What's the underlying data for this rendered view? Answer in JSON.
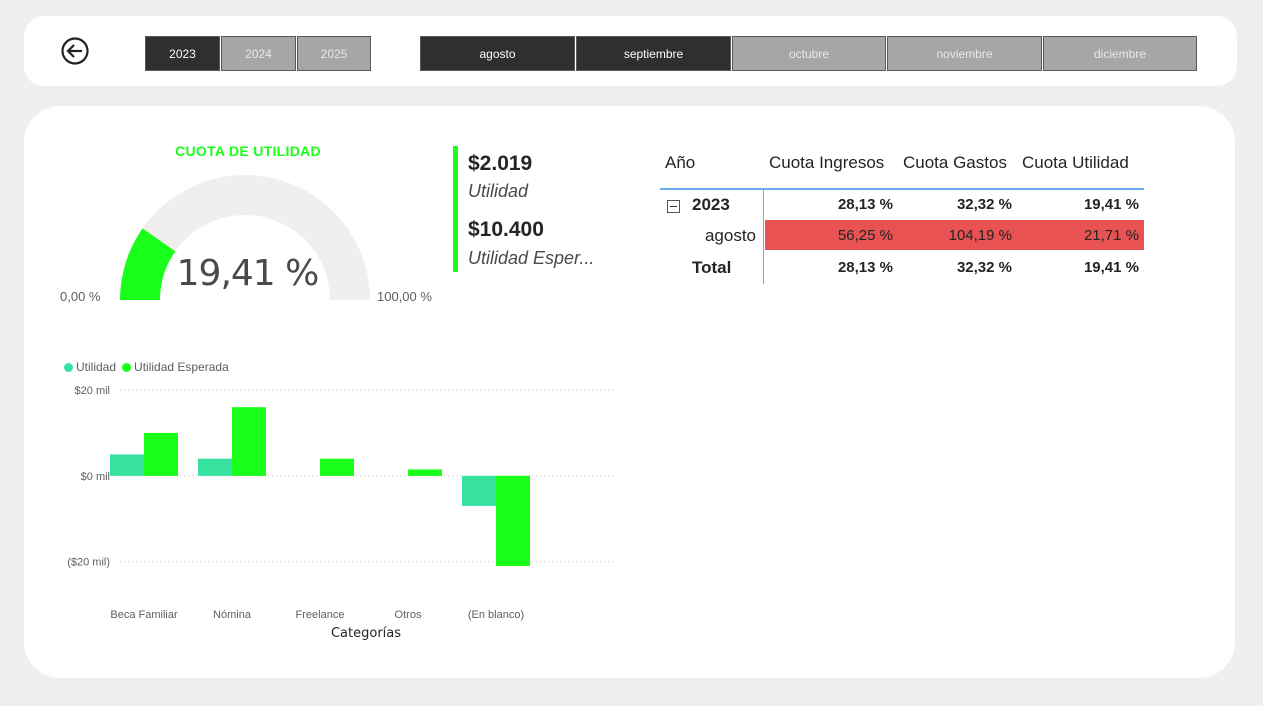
{
  "filters": {
    "years": [
      {
        "label": "2023",
        "selected": true
      },
      {
        "label": "2024",
        "selected": false
      },
      {
        "label": "2025",
        "selected": false
      }
    ],
    "months": [
      {
        "label": "agosto",
        "selected": true
      },
      {
        "label": "septiembre",
        "selected": true
      },
      {
        "label": "octubre",
        "selected": false
      },
      {
        "label": "noviembre",
        "selected": false
      },
      {
        "label": "diciembre",
        "selected": false
      }
    ]
  },
  "back_icon": "back-arrow-circle-icon",
  "gauge": {
    "title": "CUOTA DE UTILIDAD",
    "value_label": "19,41 %",
    "value": 19.41,
    "min_label": "0,00 %",
    "max_label": "100,00 %",
    "fill_color": "#19ff19",
    "track_color": "#f0efee"
  },
  "kpis": [
    {
      "value": "$2.019",
      "label": "Utilidad"
    },
    {
      "value": "$10.400",
      "label": "Utilidad Esper..."
    }
  ],
  "matrix": {
    "headers": [
      "Año",
      "Cuota Ingresos",
      "Cuota Gastos",
      "Cuota Utilidad"
    ],
    "rows": [
      {
        "label": "2023",
        "values": [
          "28,13 %",
          "32,32 %",
          "19,41 %"
        ]
      },
      {
        "label": "agosto",
        "values": [
          "56,25 %",
          "104,19 %",
          "21,71 %"
        ]
      },
      {
        "label": "Total",
        "values": [
          "28,13 %",
          "32,32 %",
          "19,41 %"
        ]
      }
    ],
    "highlight_color": "#e85252"
  },
  "chart_data": {
    "type": "bar",
    "categories": [
      "Beca Familiar",
      "Nómina",
      "Freelance",
      "Otros",
      "(En blanco)"
    ],
    "series": [
      {
        "name": "Utilidad",
        "color": "#37e2a0",
        "values": [
          5,
          4,
          0,
          0,
          -7
        ]
      },
      {
        "name": "Utilidad Esperada",
        "color": "#19ff19",
        "values": [
          10,
          16,
          4,
          1.5,
          -21
        ]
      }
    ],
    "xlabel": "Categorías",
    "yticks": [
      "$20 mil",
      "$0 mil",
      "($20 mil)"
    ],
    "ytick_values": [
      20,
      0,
      -20
    ],
    "ylim": [
      -21,
      20
    ],
    "legend": "top-left",
    "grid": true
  }
}
